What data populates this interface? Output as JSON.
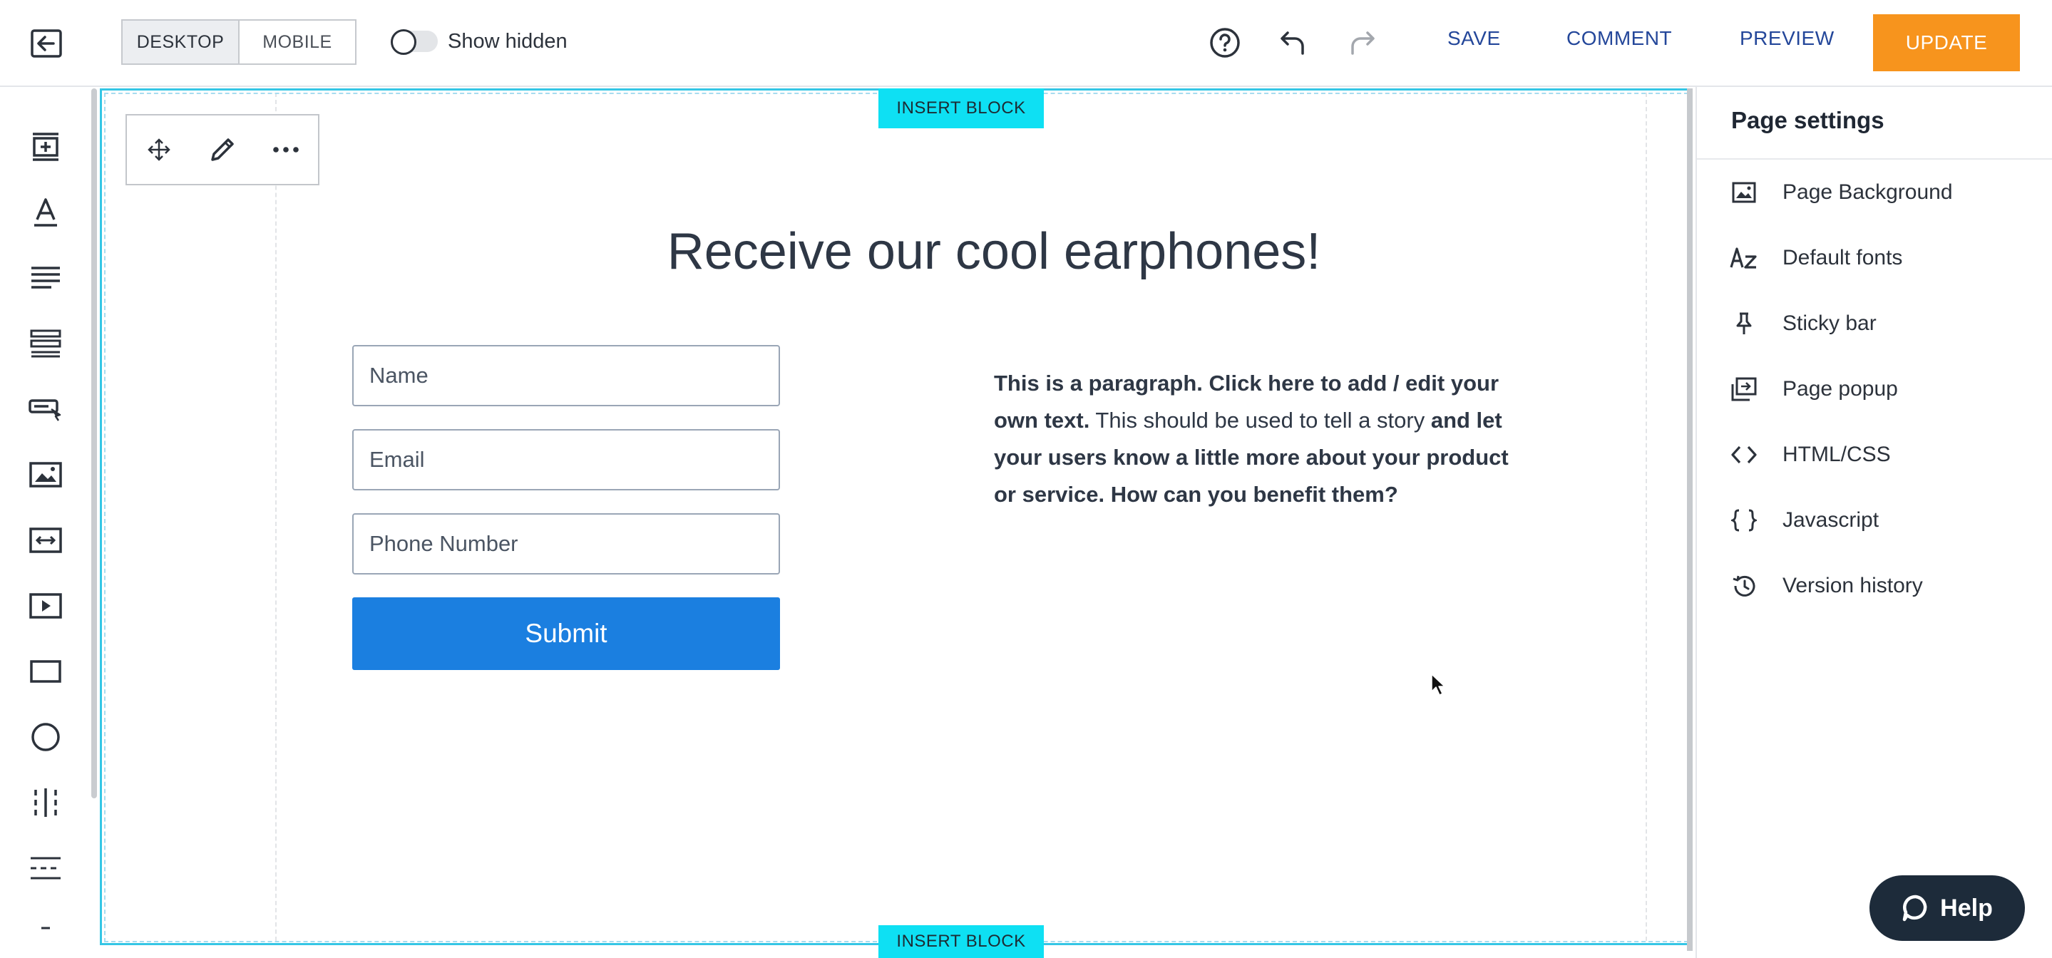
{
  "topbar": {
    "view_modes": [
      "DESKTOP",
      "MOBILE"
    ],
    "active_view": "DESKTOP",
    "show_hidden_label": "Show hidden",
    "show_hidden_on": false,
    "save_label": "SAVE",
    "comment_label": "COMMENT",
    "preview_label": "PREVIEW",
    "update_label": "UPDATE",
    "update_color": "#f7941d",
    "link_color": "#24479a"
  },
  "left_toolbar": {
    "tools": [
      "add-section-icon",
      "heading-text-icon",
      "paragraph-icon",
      "list-icon",
      "button-icon",
      "image-icon",
      "spacer-icon",
      "video-icon",
      "box-icon",
      "circle-icon",
      "columns-icon",
      "divider-icon"
    ]
  },
  "canvas": {
    "insert_block_label": "INSERT BLOCK",
    "accent_color": "#0ee0f3",
    "headline": "Receive our cool earphones!",
    "form": {
      "name_placeholder": "Name",
      "email_placeholder": "Email",
      "phone_placeholder": "Phone Number",
      "submit_label": "Submit",
      "submit_color": "#1b7fe0"
    },
    "paragraph": {
      "part1_bold": "This is a paragraph. Click here to add / edit your own text.",
      "part2": " This should be used to tell a story ",
      "part3_bold": "and let your users know a little more about your product or service. How can you benefit them?"
    }
  },
  "page_settings": {
    "title": "Page settings",
    "items": [
      {
        "label": "Page Background",
        "icon": "image-icon"
      },
      {
        "label": "Default fonts",
        "icon": "font-az-icon"
      },
      {
        "label": "Sticky bar",
        "icon": "pin-icon"
      },
      {
        "label": "Page popup",
        "icon": "popup-icon"
      },
      {
        "label": "HTML/CSS",
        "icon": "code-icon"
      },
      {
        "label": "Javascript",
        "icon": "braces-icon"
      },
      {
        "label": "Version history",
        "icon": "history-icon"
      }
    ]
  },
  "help": {
    "label": "Help"
  }
}
